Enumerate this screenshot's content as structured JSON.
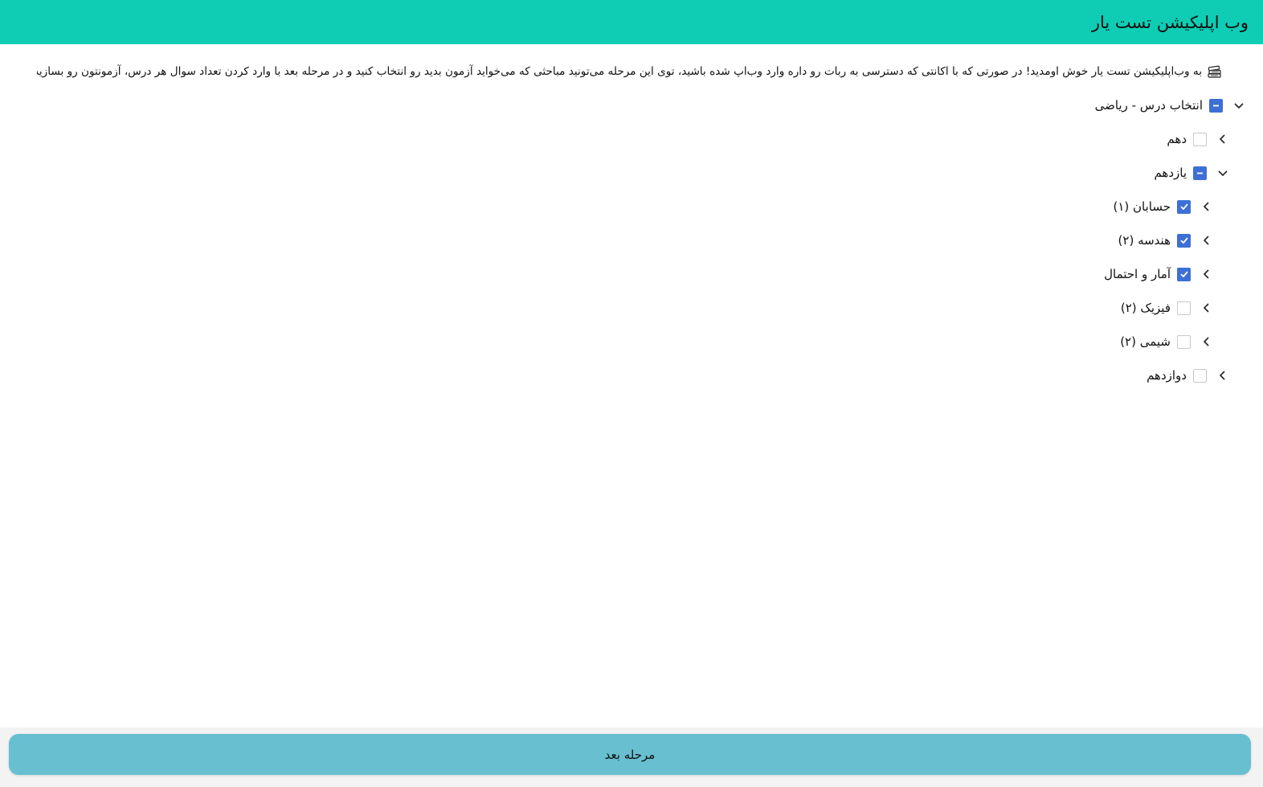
{
  "header": {
    "title": "وب اپلیکیشن تست یار",
    "color": "#0ecdb4"
  },
  "welcome": {
    "icon": "books-icon",
    "text": "به وب‌اپلیکیشن تست یار خوش اومدید! در صورتی که با اکانتی که دسترسی به ربات رو داره وارد وب‌اپ شده باشید، توی این مرحله می‌تونید مباحثی که می‌خواید آزمون بدید رو انتخاب کنید و در مرحله بعد با وارد کردن تعداد سوال هر درس، آزمونتون رو بسازید!"
  },
  "tree": {
    "root": {
      "label": "انتخاب درس - ریاضی",
      "state": "partial",
      "expanded": true
    },
    "grades": [
      {
        "label": "دهم",
        "state": "unchecked",
        "expanded": false
      },
      {
        "label": "یازدهم",
        "state": "partial",
        "expanded": true
      },
      {
        "label": "دوازدهم",
        "state": "unchecked",
        "expanded": false
      }
    ],
    "subjects": [
      {
        "label": "حسابان (۱)",
        "state": "checked",
        "expanded": false
      },
      {
        "label": "هندسه (۲)",
        "state": "checked",
        "expanded": false
      },
      {
        "label": "آمار و احتمال",
        "state": "checked",
        "expanded": false
      },
      {
        "label": "فیزیک (۲)",
        "state": "unchecked",
        "expanded": false
      },
      {
        "label": "شیمی (۲)",
        "state": "unchecked",
        "expanded": false
      }
    ]
  },
  "footer": {
    "next_label": "مرحله بعد",
    "button_color": "#67bfd0"
  },
  "colors": {
    "checkbox_active": "#3d6fd6"
  }
}
